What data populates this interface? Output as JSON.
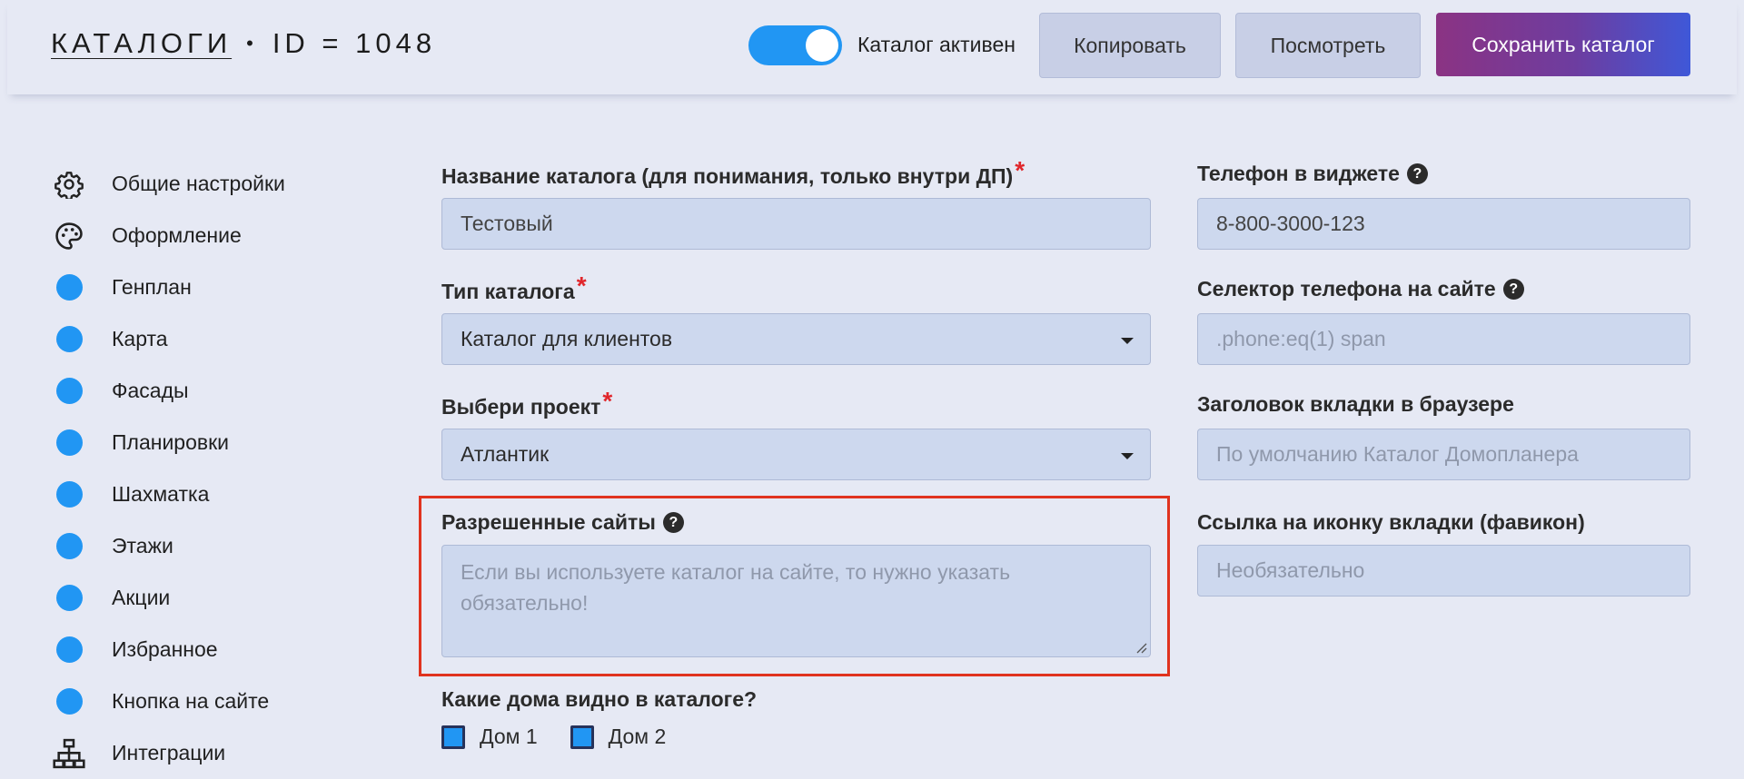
{
  "header": {
    "title_link": "КАТАЛОГИ",
    "title_sep": "•",
    "title_id": "ID = 1048",
    "toggle_label": "Каталог активен",
    "toggle_on": true,
    "buttons": {
      "copy": "Копировать",
      "view": "Посмотреть",
      "save": "Сохранить каталог"
    }
  },
  "sidebar": {
    "items": [
      {
        "label": "Общие настройки",
        "icon": "gear-icon"
      },
      {
        "label": "Оформление",
        "icon": "palette-icon"
      },
      {
        "label": "Генплан",
        "icon": "dot-icon"
      },
      {
        "label": "Карта",
        "icon": "dot-icon"
      },
      {
        "label": "Фасады",
        "icon": "dot-icon"
      },
      {
        "label": "Планировки",
        "icon": "dot-icon"
      },
      {
        "label": "Шахматка",
        "icon": "dot-icon"
      },
      {
        "label": "Этажи",
        "icon": "dot-icon"
      },
      {
        "label": "Акции",
        "icon": "dot-icon"
      },
      {
        "label": "Избранное",
        "icon": "dot-icon"
      },
      {
        "label": "Кнопка на сайте",
        "icon": "dot-icon"
      },
      {
        "label": "Интеграции",
        "icon": "sitemap-icon"
      }
    ]
  },
  "form": {
    "catalog_name": {
      "label": "Название каталога (для понимания, только внутри ДП)",
      "required_mark": "*",
      "value": "Тестовый"
    },
    "catalog_type": {
      "label": "Тип каталога",
      "required_mark": "*",
      "value": "Каталог для клиентов"
    },
    "project": {
      "label": "Выбери проект",
      "required_mark": "*",
      "value": "Атлантик"
    },
    "allowed_sites": {
      "label": "Разрешенные сайты",
      "help": "?",
      "placeholder": "Если вы используете каталог на сайте, то нужно указать обязательно!"
    },
    "houses": {
      "label": "Какие дома видно в каталоге?",
      "options": [
        {
          "label": "Дом 1",
          "checked": true
        },
        {
          "label": "Дом 2",
          "checked": true
        }
      ]
    },
    "widget_phone": {
      "label": "Телефон в виджете",
      "help": "?",
      "value": "8-800-3000-123"
    },
    "phone_selector": {
      "label": "Селектор телефона на сайте",
      "help": "?",
      "placeholder": ".phone:eq(1) span"
    },
    "tab_title": {
      "label": "Заголовок вкладки в браузере",
      "placeholder": "По умолчанию Каталог Домопланера"
    },
    "favicon": {
      "label": "Ссылка на иконку вкладки (фавикон)",
      "placeholder": "Необязательно"
    }
  },
  "colors": {
    "accent": "#2196f3",
    "background": "#e6e9f4",
    "input_bg": "#cdd8ee",
    "highlight": "#e0331f",
    "required": "#e0262b"
  }
}
